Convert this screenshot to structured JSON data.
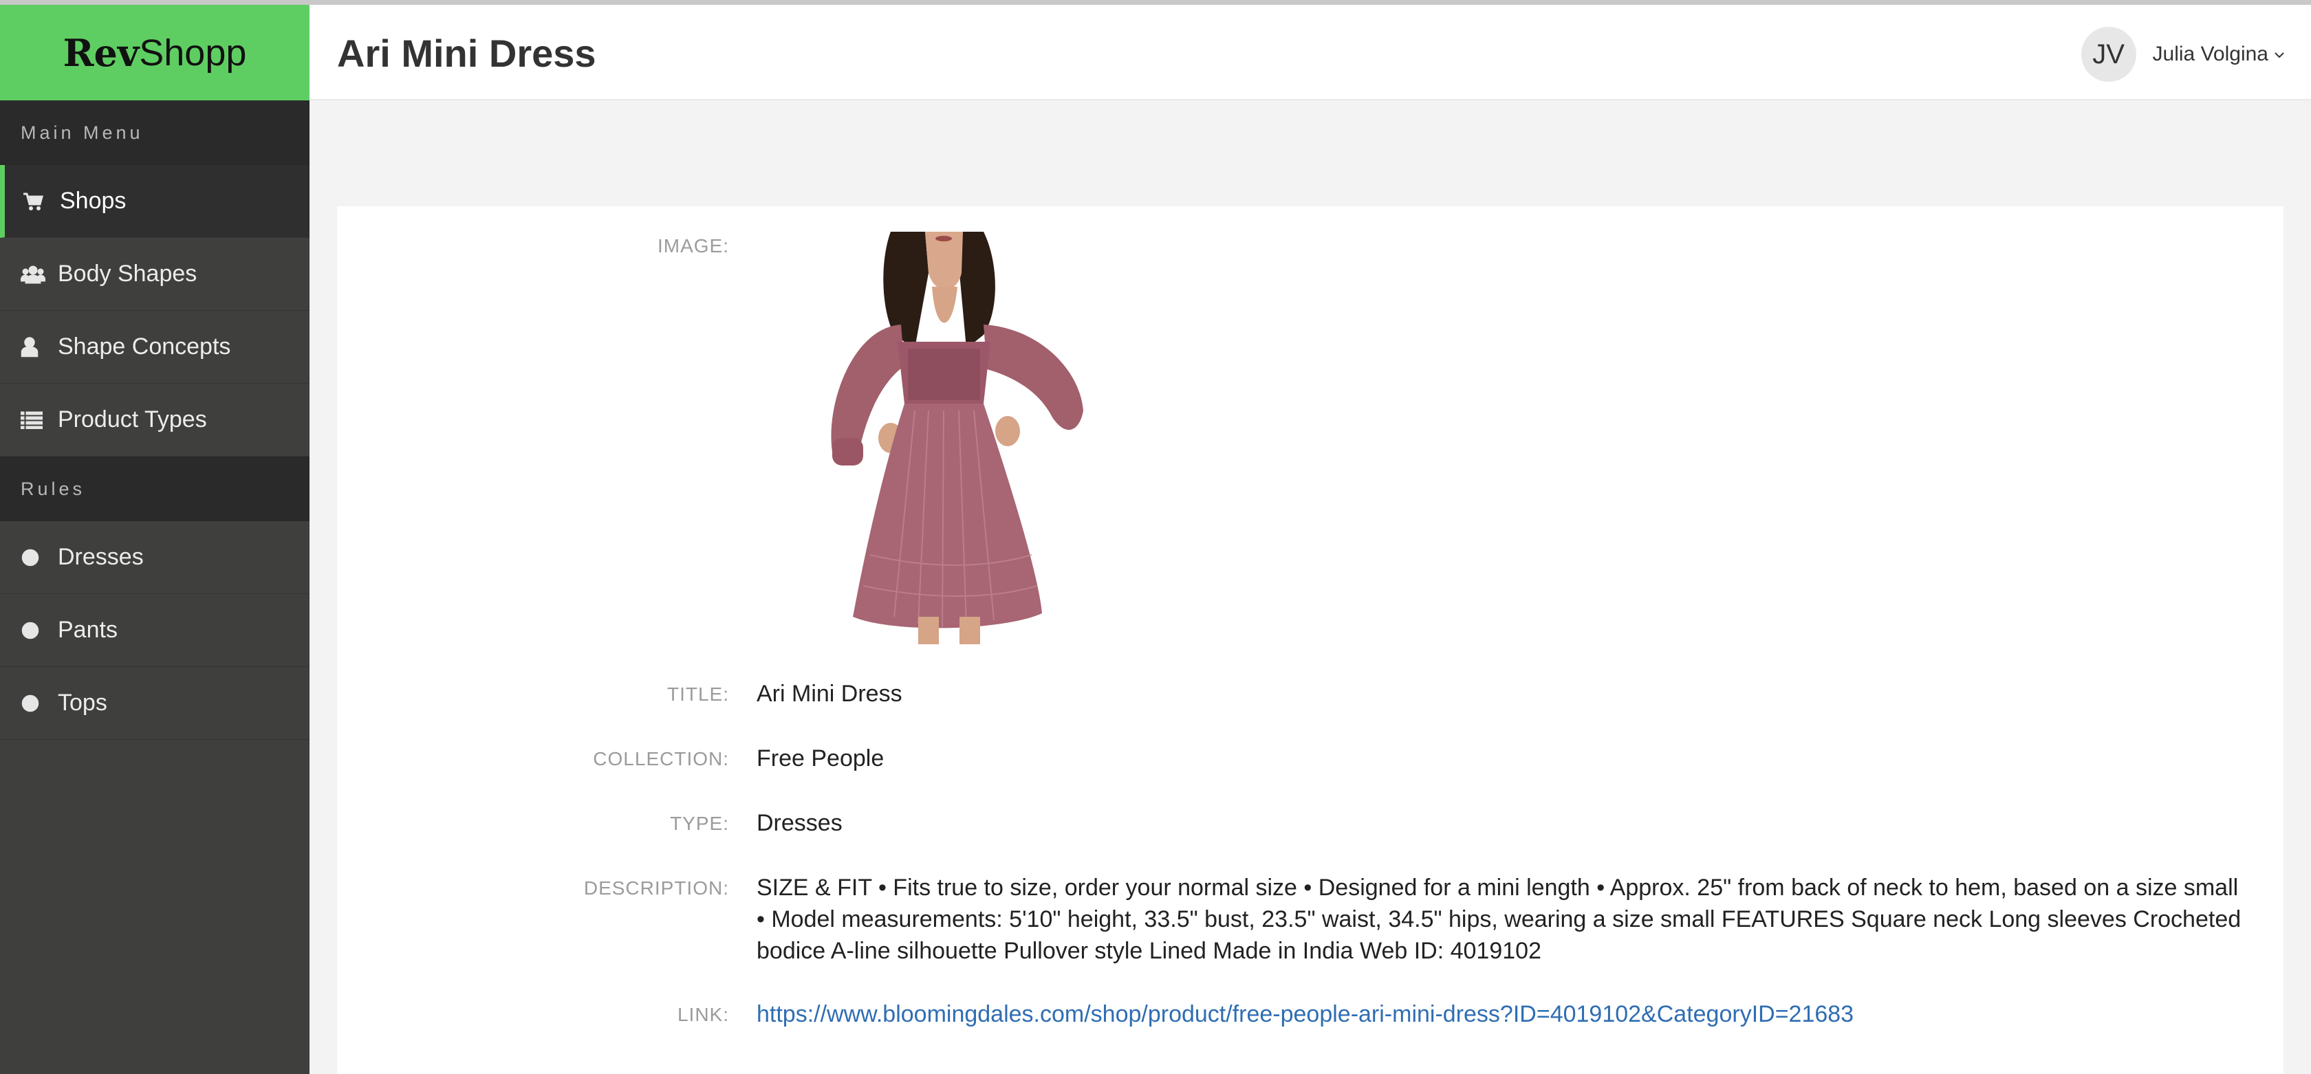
{
  "brand": {
    "part1": "Rev",
    "part2": "Shopp"
  },
  "sidebar": {
    "sections": [
      {
        "label": "Main Menu",
        "items": [
          {
            "label": "Shops",
            "icon": "cart-icon",
            "active": true
          },
          {
            "label": "Body Shapes",
            "icon": "users-icon"
          },
          {
            "label": "Shape Concepts",
            "icon": "user-outline-icon"
          },
          {
            "label": "Product Types",
            "icon": "list-icon"
          }
        ]
      },
      {
        "label": "Rules",
        "items": [
          {
            "label": "Dresses",
            "icon": "circle-outline-icon"
          },
          {
            "label": "Pants",
            "icon": "circle-outline-icon"
          },
          {
            "label": "Tops",
            "icon": "circle-outline-icon"
          }
        ]
      }
    ]
  },
  "header": {
    "title": "Ari Mini Dress",
    "user": {
      "initials": "JV",
      "name": "Julia Volgina"
    }
  },
  "product": {
    "labels": {
      "image": "IMAGE:",
      "title": "TITLE:",
      "collection": "COLLECTION:",
      "type": "TYPE:",
      "description": "DESCRIPTION:",
      "link": "LINK:"
    },
    "title": "Ari Mini Dress",
    "collection": "Free People",
    "type": "Dresses",
    "description": "SIZE & FIT • Fits true to size, order your normal size • Designed for a mini length • Approx. 25\" from back of neck to hem, based on a size small • Model measurements: 5'10\" height, 33.5\" bust, 23.5\" waist, 34.5\" hips, wearing a size small FEATURES Square neck Long sleeves Crocheted bodice A-line silhouette Pullover style Lined Made in India Web ID: 4019102",
    "link": "https://www.bloomingdales.com/shop/product/free-people-ari-mini-dress?ID=4019102&CategoryID=21683"
  },
  "colors": {
    "accent": "#5fce62",
    "sidebar": "#3f3f3d",
    "section": "#2a2a2a",
    "link": "#2f6db3"
  }
}
